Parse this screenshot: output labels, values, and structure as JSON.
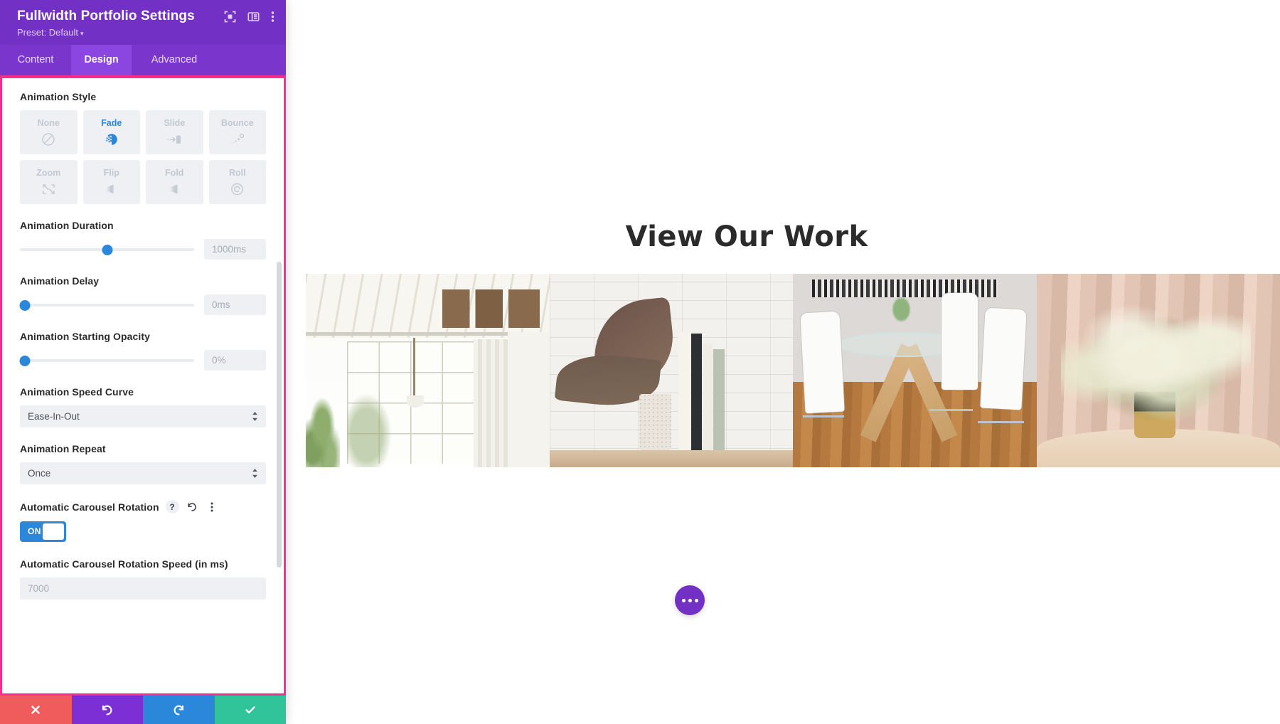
{
  "panel": {
    "title": "Fullwidth Portfolio Settings",
    "preset_label": "Preset: Default",
    "preset_caret": "▾",
    "header_icons": [
      {
        "name": "focus-frame-icon"
      },
      {
        "name": "layout-panel-icon"
      },
      {
        "name": "kebab-menu-icon"
      }
    ],
    "tabs": [
      {
        "label": "Content",
        "active": false
      },
      {
        "label": "Design",
        "active": true
      },
      {
        "label": "Advanced",
        "active": false
      }
    ],
    "animation_style": {
      "label": "Animation Style",
      "options": [
        {
          "label": "None",
          "icon": "no-entry-icon",
          "selected": false
        },
        {
          "label": "Fade",
          "icon": "fade-icon",
          "selected": true
        },
        {
          "label": "Slide",
          "icon": "slide-icon",
          "selected": false
        },
        {
          "label": "Bounce",
          "icon": "bounce-icon",
          "selected": false
        },
        {
          "label": "Zoom",
          "icon": "zoom-arrows-icon",
          "selected": false
        },
        {
          "label": "Flip",
          "icon": "flip-icon",
          "selected": false
        },
        {
          "label": "Fold",
          "icon": "fold-icon",
          "selected": false
        },
        {
          "label": "Roll",
          "icon": "roll-spiral-icon",
          "selected": false
        }
      ]
    },
    "animation_duration": {
      "label": "Animation Duration",
      "value": "1000ms",
      "slider_percent": 50
    },
    "animation_delay": {
      "label": "Animation Delay",
      "value": "0ms",
      "slider_percent": 0
    },
    "animation_starting_opacity": {
      "label": "Animation Starting Opacity",
      "value": "0%",
      "slider_percent": 0
    },
    "animation_speed_curve": {
      "label": "Animation Speed Curve",
      "value": "Ease-In-Out"
    },
    "animation_repeat": {
      "label": "Animation Repeat",
      "value": "Once"
    },
    "automatic_carousel_rotation": {
      "label": "Automatic Carousel Rotation",
      "help_icon": "?",
      "reset_icon": "↺",
      "more_icon": "⋮",
      "toggle_state": "ON"
    },
    "automatic_carousel_rotation_speed": {
      "label": "Automatic Carousel Rotation Speed (in ms)",
      "value": "7000"
    },
    "actions": [
      {
        "name": "cancel-button",
        "icon": "close-x-icon",
        "color": "#f05b5b"
      },
      {
        "name": "undo-button",
        "icon": "undo-arrow-icon",
        "color": "#7c2fd4"
      },
      {
        "name": "redo-button",
        "icon": "redo-arrow-icon",
        "color": "#2b87da"
      },
      {
        "name": "save-button",
        "icon": "checkmark-icon",
        "color": "#31c49b"
      }
    ]
  },
  "canvas": {
    "heading": "View Our Work",
    "slides": [
      {
        "alt": "White industrial loft interior with large window"
      },
      {
        "alt": "Plant and stacked books against white brick wall"
      },
      {
        "alt": "Glass dining table with white chairs on wood floor"
      },
      {
        "alt": "White floral arrangement in vase against beige curtain"
      }
    ],
    "fab": {
      "name": "page-settings-fab",
      "icon": "three-dots-icon"
    }
  },
  "colors": {
    "panel_header": "#7230c4",
    "tab_active": "#8b45e0",
    "accent_blue": "#2b87da",
    "highlight_border": "#f4308f",
    "fab": "#7230c4"
  }
}
